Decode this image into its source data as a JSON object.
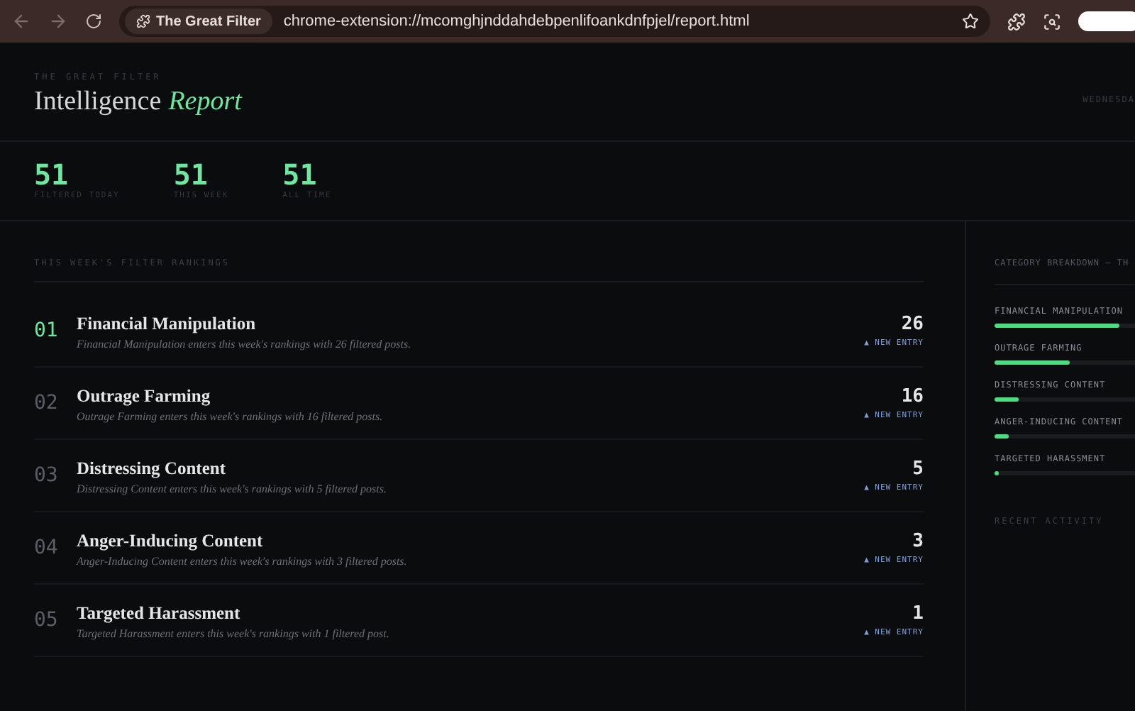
{
  "browser": {
    "extension_chip": "The Great Filter",
    "url": "chrome-extension://mcomghjnddahdebpenlifoankdnfpjel/report.html"
  },
  "header": {
    "eyebrow": "THE GREAT FILTER",
    "title": "Intelligence",
    "title_accent": "Report",
    "date": "WEDNESDA"
  },
  "stats": [
    {
      "value": "51",
      "label": "FILTERED TODAY"
    },
    {
      "value": "51",
      "label": "THIS WEEK"
    },
    {
      "value": "51",
      "label": "ALL TIME"
    }
  ],
  "rankings": {
    "heading": "THIS WEEK'S FILTER RANKINGS",
    "items": [
      {
        "rank": "01",
        "highlighted": true,
        "name": "Financial Manipulation",
        "description": "Financial Manipulation enters this week's rankings with 26 filtered posts.",
        "count": "26",
        "badge": "▲ NEW ENTRY"
      },
      {
        "rank": "02",
        "highlighted": false,
        "name": "Outrage Farming",
        "description": "Outrage Farming enters this week's rankings with 16 filtered posts.",
        "count": "16",
        "badge": "▲ NEW ENTRY"
      },
      {
        "rank": "03",
        "highlighted": false,
        "name": "Distressing Content",
        "description": "Distressing Content enters this week's rankings with 5 filtered posts.",
        "count": "5",
        "badge": "▲ NEW ENTRY"
      },
      {
        "rank": "04",
        "highlighted": false,
        "name": "Anger-Inducing Content",
        "description": "Anger-Inducing Content enters this week's rankings with 3 filtered posts.",
        "count": "3",
        "badge": "▲ NEW ENTRY"
      },
      {
        "rank": "05",
        "highlighted": false,
        "name": "Targeted Harassment",
        "description": "Targeted Harassment enters this week's rankings with 1 filtered post.",
        "count": "1",
        "badge": "▲ NEW ENTRY"
      }
    ]
  },
  "sidebar": {
    "heading": "CATEGORY BREAKDOWN — TH",
    "categories": [
      {
        "name": "FINANCIAL MANIPULATION",
        "level": 0.51
      },
      {
        "name": "OUTRAGE FARMING",
        "level": 0.31
      },
      {
        "name": "DISTRESSING CONTENT",
        "level": 0.1
      },
      {
        "name": "ANGER-INDUCING CONTENT",
        "level": 0.06
      },
      {
        "name": "TARGETED HARASSMENT",
        "level": 0.02
      }
    ],
    "recent_heading": "RECENT ACTIVITY"
  }
}
